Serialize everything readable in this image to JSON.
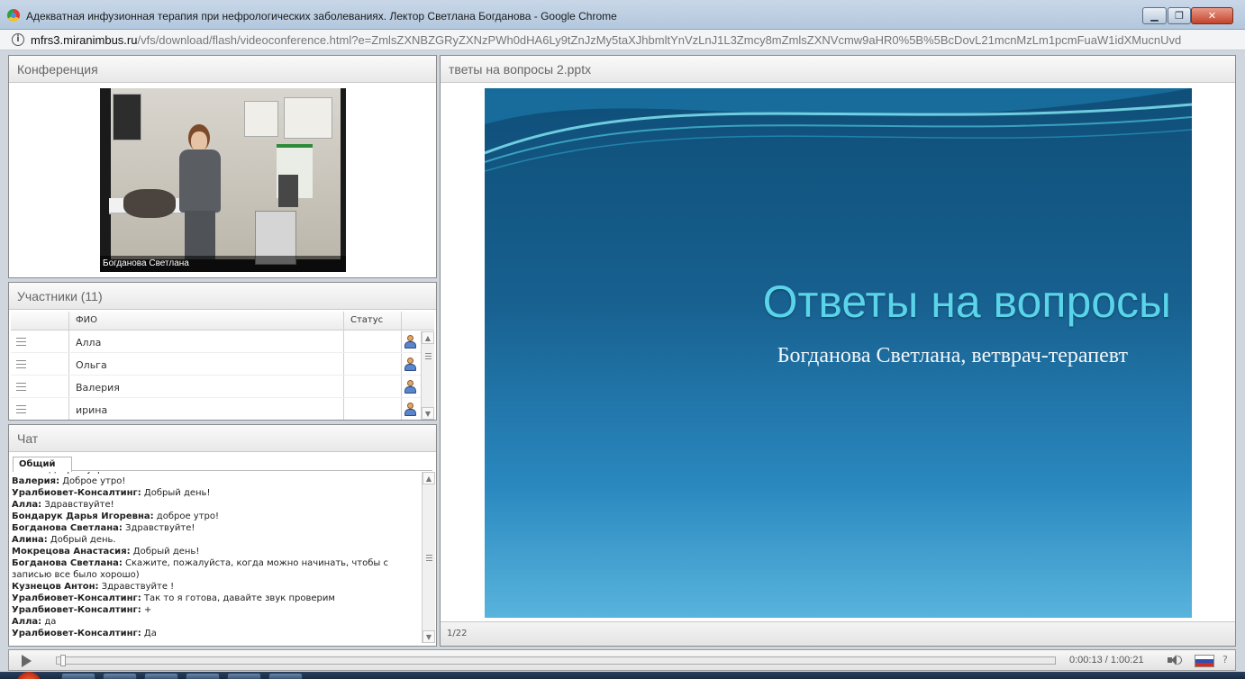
{
  "window": {
    "title": "Адекватная инфузионная терапия при нефрологических заболеваниях. Лектор Светлана Богданова - Google Chrome",
    "min_label": "▁",
    "max_label": "❐",
    "close_label": "✕"
  },
  "url": {
    "host": "mfrs3.miranimbus.ru",
    "path": "/vfs/download/flash/videoconference.html?e=ZmlsZXNBZGRyZXNzPWh0dHA6Ly9tZnJzMy5taXJhbmltYnVzLnJ1L3Zmcy8mZmlsZXNVcmw9aHR0%5B%5BcDovL21mcnMzLm1pcmFuaW1idXMucnUvd"
  },
  "conference": {
    "title": "Конференция",
    "video_caption": "Богданова Светлана"
  },
  "participants": {
    "title": "Участники (11)",
    "columns": {
      "name": "ФИО",
      "status": "Статус"
    },
    "rows": [
      {
        "name": "Алла"
      },
      {
        "name": "Ольга"
      },
      {
        "name": "Валерия"
      },
      {
        "name": "ирина"
      }
    ]
  },
  "chat": {
    "title": "Чат",
    "tab": "Общий",
    "messages": [
      {
        "author": "Ольга:",
        "text": " Доброе утро!"
      },
      {
        "author": "Валерия:",
        "text": " Доброе утро!"
      },
      {
        "author": "Уралбиовет-Консалтинг:",
        "text": " Добрый день!"
      },
      {
        "author": "Алла:",
        "text": " Здравствуйте!"
      },
      {
        "author": "Бондарук Дарья  Игоревна:",
        "text": " доброе утро!"
      },
      {
        "author": "Богданова Светлана:",
        "text": " Здравствуйте!"
      },
      {
        "author": "Алина:",
        "text": " Добрый день."
      },
      {
        "author": "Мокрецова Анастасия:",
        "text": " Добрый день!"
      },
      {
        "author": "Богданова Светлана:",
        "text": " Скажите, пожалуйста, когда можно начинать, чтобы с записью все было хорошо)"
      },
      {
        "author": "Кузнецов Антон:",
        "text": " Здравствуйте !"
      },
      {
        "author": "Уралбиовет-Консалтинг:",
        "text": " Так то я готова, давайте звук проверим"
      },
      {
        "author": "Уралбиовет-Консалтинг:",
        "text": " +"
      },
      {
        "author": "Алла:",
        "text": " да"
      },
      {
        "author": "Уралбиовет-Консалтинг:",
        "text": " Да"
      }
    ]
  },
  "presentation": {
    "file_title": "тветы на вопросы 2.pptx",
    "slide_title": "Ответы на вопросы",
    "slide_subtitle": "Богданова Светлана, ветврач-терапевт",
    "page": "1/22"
  },
  "player": {
    "time": "0:00:13 / 1:00:21",
    "progress_fraction": 0.0036,
    "help": "?"
  }
}
